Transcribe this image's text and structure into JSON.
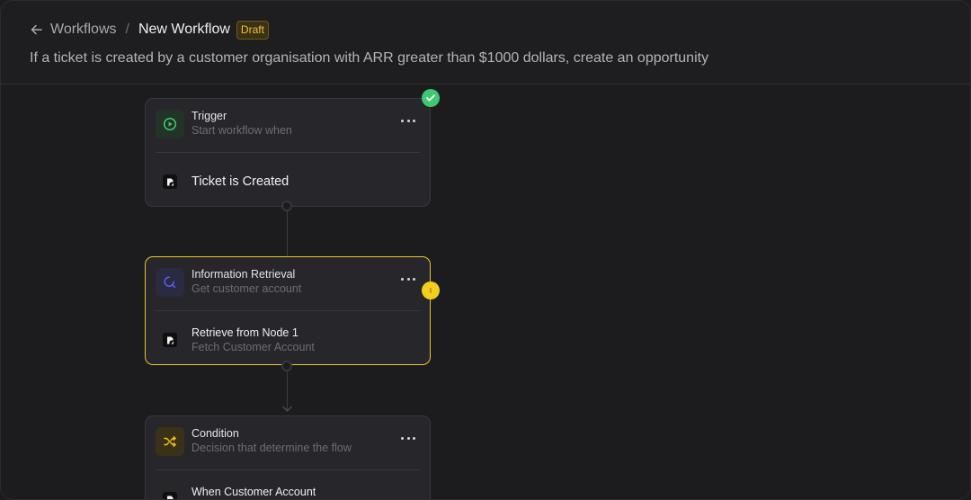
{
  "header": {
    "breadcrumb_parent": "Workflows",
    "separator": "/",
    "title": "New Workflow",
    "badge": "Draft",
    "description": "If a ticket is created by a customer organisation with ARR greater than $1000 dollars, create an opportunity"
  },
  "nodes": [
    {
      "title": "Trigger",
      "subtitle": "Start workflow when",
      "icon": "play-circle-icon",
      "body_title": "Ticket is Created",
      "status": "complete"
    },
    {
      "title": "Information Retrieval",
      "subtitle": "Get customer account",
      "icon": "search-icon",
      "body_title": "Retrieve from Node 1",
      "body_subtitle": "Fetch Customer Account",
      "status": "pending"
    },
    {
      "title": "Condition",
      "subtitle": "Decision that determine the flow",
      "icon": "shuffle-icon",
      "body_title": "When Customer Account"
    }
  ],
  "colors": {
    "accent_yellow": "#e8c62a",
    "success_green": "#3fc872",
    "trigger_green": "#3ccf6a",
    "retrieval_indigo": "#5b5ef0",
    "condition_yellow": "#f0c420"
  }
}
